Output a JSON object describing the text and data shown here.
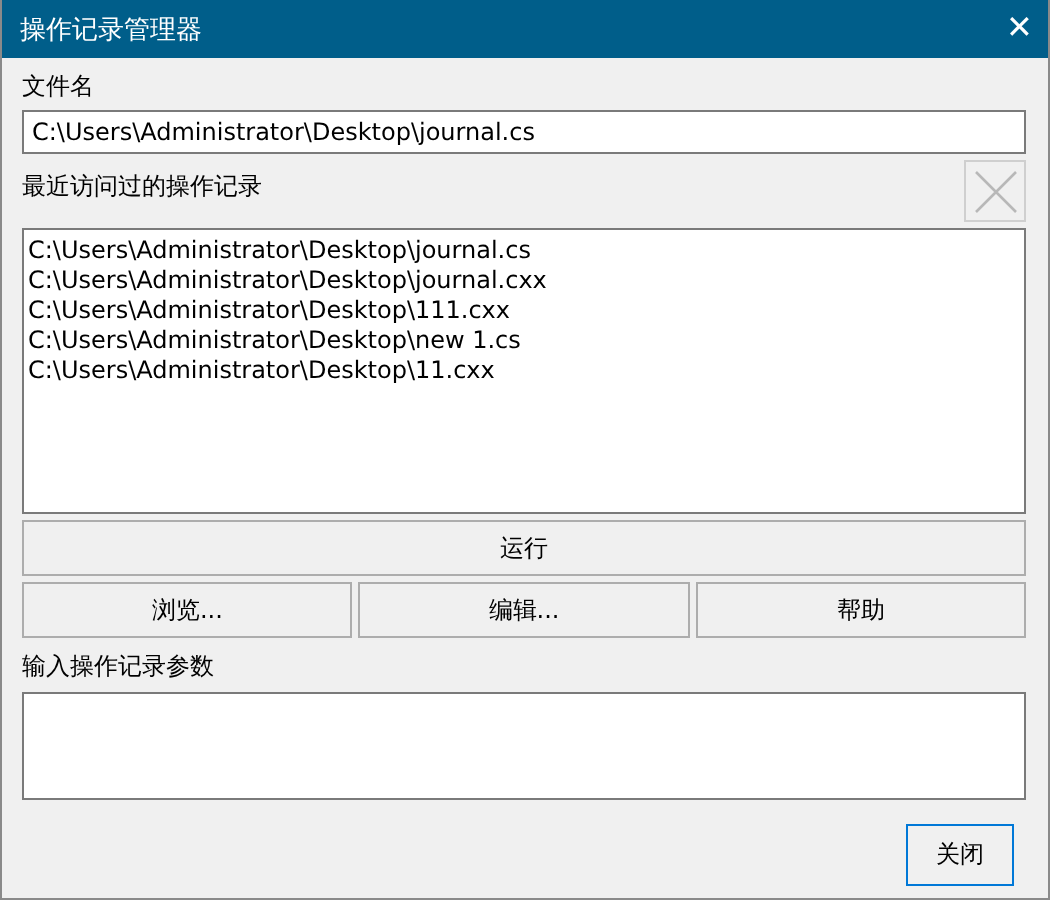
{
  "window": {
    "title": "操作记录管理器",
    "close": "✕"
  },
  "file_name": {
    "label": "文件名",
    "value": "C:\\Users\\Administrator\\Desktop\\journal.cs"
  },
  "recent": {
    "label": "最近访问过的操作记录",
    "delete_button": {
      "disabled": true
    },
    "items": [
      {
        "text": "C:\\Users\\Administrator\\Desktop\\journal.cs",
        "selected": false
      },
      {
        "text": "C:\\Users\\Administrator\\Desktop\\journal.cxx",
        "selected": false
      },
      {
        "text": "C:\\Users\\Administrator\\Desktop\\111.cxx",
        "selected": false
      },
      {
        "text": "C:\\Users\\Administrator\\Desktop\\new 1.cs",
        "selected": false
      },
      {
        "text": "C:\\Users\\Administrator\\Desktop\\11.cxx",
        "selected": false
      }
    ]
  },
  "run_button": "运行",
  "buttons": [
    "浏览...",
    "编辑...",
    "帮助"
  ],
  "params": {
    "label": "输入操作记录参数"
  },
  "close_button": "关闭"
}
